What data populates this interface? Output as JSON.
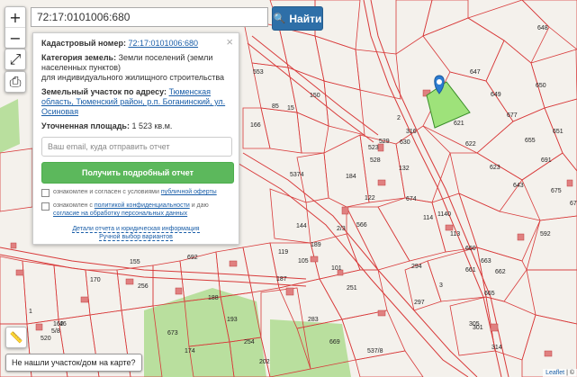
{
  "search": {
    "value": "72:17:0101006:680",
    "button_label": "Найти"
  },
  "map_controls": {
    "zoom_in": "+",
    "zoom_out": "−"
  },
  "panel": {
    "cadastral_label": "Кадастровый номер:",
    "cadastral_value": "72:17:0101006:680",
    "category_label": "Категория земель:",
    "category_value": "Земли поселений (земли населенных пунктов)",
    "category_purpose": "для индивидуального жилищного строительства",
    "address_label": "Земельный участок по адресу:",
    "address_value": "Тюменская область, Тюменский район, р.п. Боганинский, ул. Осиновая",
    "area_label": "Уточненная площадь:",
    "area_value": "1 523 кв.м.",
    "email_placeholder": "Ваш email, куда отправить отчет",
    "get_report_label": "Получить подробный отчет",
    "consent_1_prefix": "ознакомлен и согласен с условиями",
    "consent_1_link": "публичной оферты",
    "consent_2_prefix": "ознакомлен с",
    "consent_2_link": "политикой конфиденциальности",
    "consent_2_mid": "и даю",
    "consent_2_link2": "согласие на обработку персональных данных",
    "link_details": "Детали отчета и юридическая информация",
    "link_manual": "Ручной выбор вариантов"
  },
  "not_found_label": "Не нашли участок/дом на карте?",
  "attribution": {
    "leaflet": "Leaflet",
    "sep": " | © "
  },
  "parcel_labels": [
    "648",
    "647",
    "649",
    "650",
    "677",
    "621",
    "651",
    "655",
    "622",
    "623",
    "691",
    "675",
    "643",
    "676",
    "592",
    "113",
    "114",
    "1140",
    "674",
    "132",
    "184",
    "122",
    "566",
    "523",
    "528",
    "529",
    "630",
    "316",
    "2",
    "150",
    "553",
    "85",
    "15",
    "166",
    "144",
    "189",
    "119",
    "101",
    "105",
    "251",
    "294",
    "660",
    "661",
    "663",
    "662",
    "3",
    "665",
    "297",
    "305",
    "301",
    "314",
    "187",
    "188",
    "193",
    "283",
    "254",
    "669",
    "673",
    "174",
    "202",
    "692",
    "256",
    "155",
    "170",
    "1",
    "128",
    "162",
    "46",
    "520",
    "5/8",
    "2/3",
    "5374",
    "537/8",
    "57/46"
  ],
  "colors": {
    "parcel_line": "#d83a3a",
    "selected_parcel": "#9ee27a",
    "green_zone": "#b9df9e",
    "search_button": "#2e6fa8",
    "report_button": "#5cb85c",
    "marker": "#2b7bd0"
  }
}
